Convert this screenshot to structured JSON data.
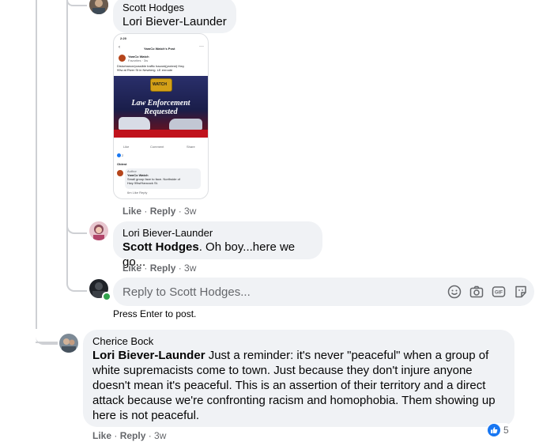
{
  "comments": [
    {
      "author": "Scott Hodges",
      "mention": "Lori Biever-Launder",
      "actions": {
        "like": "Like",
        "reply": "Reply",
        "time": "3w"
      }
    },
    {
      "author": "Lori Biever-Launder",
      "mention": "Scott Hodges",
      "text": ". Oh boy...here we go...",
      "actions": {
        "like": "Like",
        "reply": "Reply",
        "time": "3w"
      }
    },
    {
      "author": "Cherice Bock",
      "mention": "Lori Biever-Launder",
      "text": " Just a reminder: it's never \"peaceful\" when a group of white supremacists come to town. Just because they don't injure anyone doesn't mean it's peaceful. This is an assertion of their territory and a direct attack because we're confronting racism and homophobia. Them showing up here is not peaceful.",
      "actions": {
        "like": "Like",
        "reply": "Reply",
        "time": "3w"
      },
      "reaction_count": "5"
    }
  ],
  "reply_box": {
    "placeholder": "Reply to Scott Hodges...",
    "hint": "Press Enter to post.",
    "tools": [
      "emoji-icon",
      "camera-icon",
      "gif-icon",
      "sticker-icon"
    ]
  },
  "attachment": {
    "status_time": "2:20",
    "header": "YamCo Watch's Post",
    "page_name": "YamCo Watch",
    "meta": "Favorites · 3w",
    "post_text_1": "Disturbance/possible traffic hazard(protest) Hwy",
    "post_text_2": "99w at River St in Newberg. LE enroute",
    "banner_logo": "WATCH",
    "banner_line1": "Law Enforcement",
    "banner_line2": "Requested",
    "like": "Like",
    "comment": "Comment",
    "share": "Share",
    "reaction_count": "2",
    "sort": "Oldest",
    "sub_label": "Author",
    "sub_author": "YamCo Watch",
    "sub_text_1": "Small group face to face. Northside of",
    "sub_text_2": "Hwy 99w/Hancock St.",
    "sub_actions": "6m   Like   Reply"
  },
  "colors": {
    "bubble": "#f0f2f5",
    "secondary_text": "#65676b",
    "like_blue": "#1877f2",
    "online_green": "#31a24c",
    "banner_red": "#c0121c"
  }
}
